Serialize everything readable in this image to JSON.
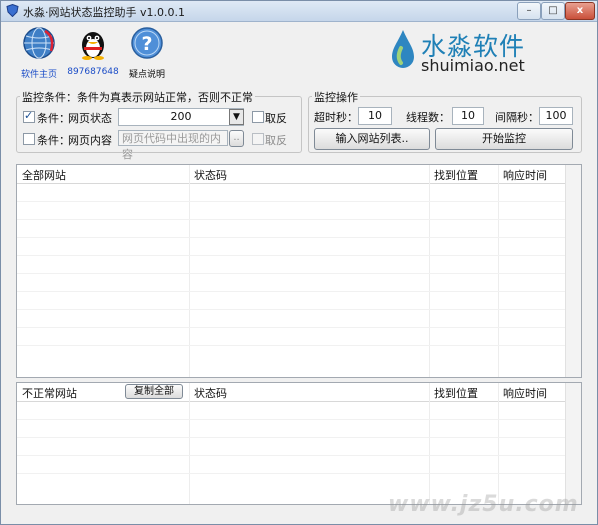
{
  "window": {
    "title": "水淼·网站状态监控助手 v1.0.0.1",
    "min_symbol": "–",
    "max_symbol": "□",
    "close_symbol": "x"
  },
  "toolbar": {
    "items": [
      {
        "label": "软件主页",
        "icon": "globe-icon",
        "color": "#1a4cc7"
      },
      {
        "label": "897687648",
        "icon": "qq-penguin-icon",
        "color": "#1a4cc7"
      },
      {
        "label": "疑点说明",
        "icon": "help-icon",
        "color": "#111111"
      }
    ]
  },
  "brand": {
    "name": "水淼软件",
    "url": "shuimiao.net",
    "color": "#1f80b6"
  },
  "conditions": {
    "legend": "监控条件：条件为真表示网站正常，否则不正常",
    "row1": {
      "checked": true,
      "prefix": "条件：",
      "label": "网页状态",
      "value": "200",
      "invert_label": "取反"
    },
    "row2": {
      "checked": false,
      "prefix": "条件：",
      "label": "网页内容",
      "placeholder": "网页代码中出现的内容",
      "browse": "..",
      "invert_label": "取反"
    }
  },
  "monitor": {
    "legend": "监控操作",
    "timeout_label": "超时秒：",
    "timeout_value": "10",
    "threads_label": "线程数：",
    "threads_value": "10",
    "interval_label": "间隔秒：",
    "interval_value": "100",
    "import_button": "输入网站列表..",
    "start_button": "开始监控"
  },
  "all_sites": {
    "columns": [
      "全部网站",
      "状态码",
      "找到位置",
      "响应时间"
    ]
  },
  "abnormal_sites": {
    "columns": [
      "不正常网站",
      "状态码",
      "找到位置",
      "响应时间"
    ],
    "copy_button": "复制全部"
  },
  "watermark": "www.jz5u.com"
}
